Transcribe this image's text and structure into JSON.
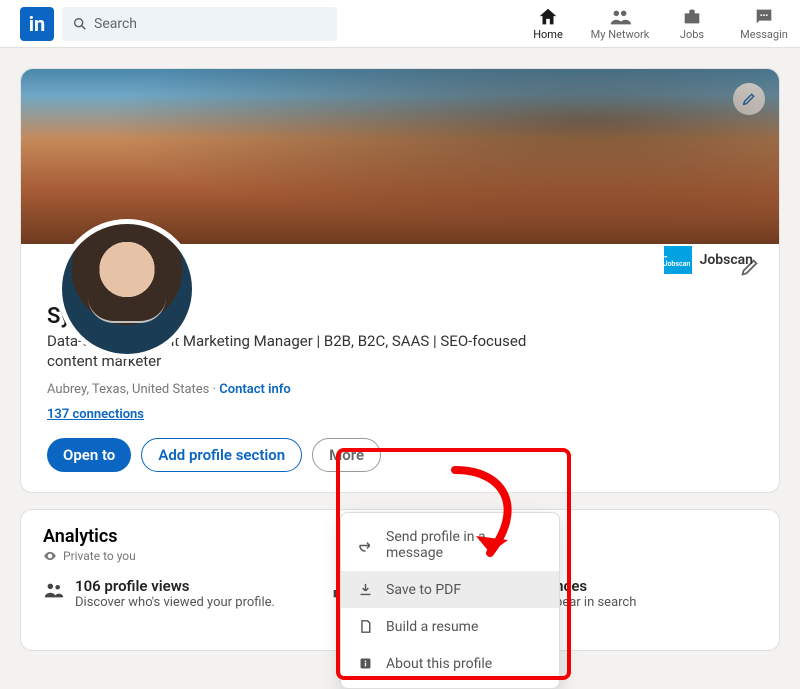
{
  "search": {
    "placeholder": "Search"
  },
  "nav": {
    "home": "Home",
    "network": "My Network",
    "jobs": "Jobs",
    "messaging": "Messagin"
  },
  "profile": {
    "name": "Sydney Myers",
    "headline": "Data-driven Content Marketing Manager | B2B, B2C, SAAS | SEO-focused content marketer",
    "location": "Aubrey, Texas, United States",
    "contact_link": "Contact info",
    "connections": "137 connections",
    "company": "Jobscan"
  },
  "actions": {
    "open_to": "Open to",
    "add_section": "Add profile section",
    "more": "More"
  },
  "menu": {
    "send_profile": "Send profile in a message",
    "save_pdf": "Save to PDF",
    "build_resume": "Build a resume",
    "about_profile": "About this profile"
  },
  "analytics": {
    "title": "Analytics",
    "private": "Private to you",
    "profile_views_title": "106 profile views",
    "profile_views_sub": "Discover who's viewed your profile.",
    "search_title": "72 search appearances",
    "search_sub": "See how often you appear in search results."
  }
}
